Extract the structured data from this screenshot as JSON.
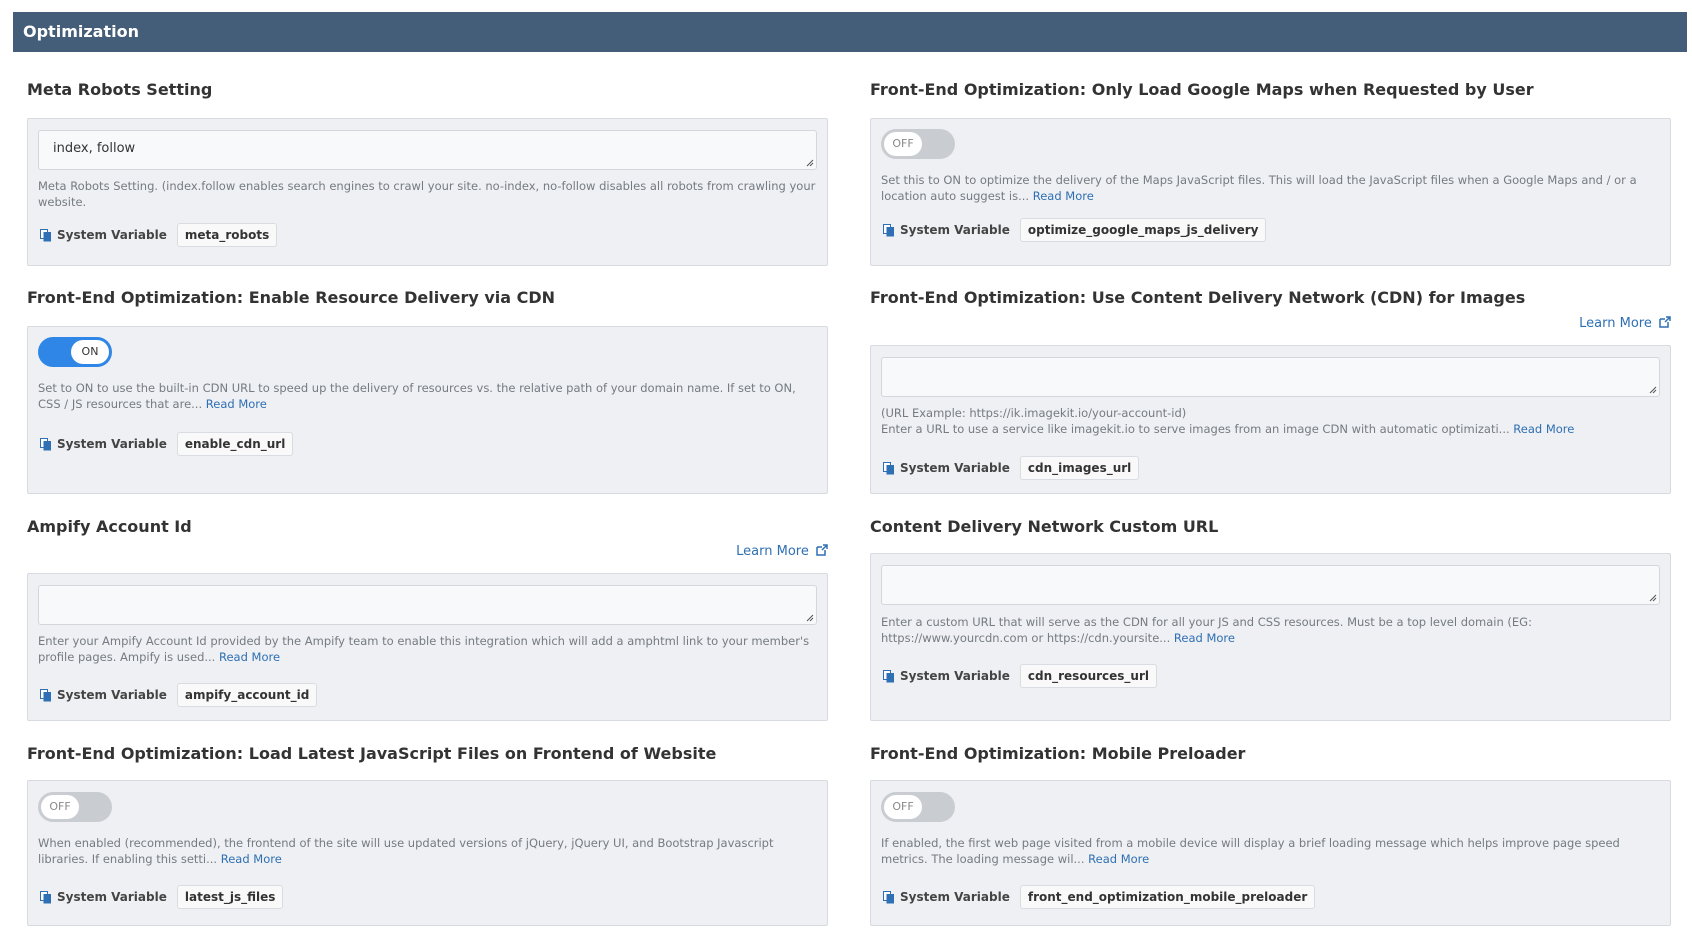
{
  "header": {
    "title": "Optimization"
  },
  "common": {
    "system_variable_label": "System Variable",
    "read_more": "Read More",
    "learn_more": "Learn More"
  },
  "fields": {
    "meta_robots": {
      "label": "Meta Robots Setting",
      "value": "index, follow",
      "description": "Meta Robots Setting. (index.follow enables search engines to crawl your site. no-index, no-follow disables all robots from crawling your website.",
      "variable": "meta_robots"
    },
    "google_maps": {
      "label": "Front-End Optimization: Only Load Google Maps when Requested by User",
      "toggle": "OFF",
      "description": "Set this to ON to optimize the delivery of the Maps JavaScript files. This will load the JavaScript files when a Google Maps and / or a location auto suggest is...",
      "variable": "optimize_google_maps_js_delivery"
    },
    "cdn_url": {
      "label": "Front-End Optimization: Enable Resource Delivery via CDN",
      "toggle": "ON",
      "description": "Set to ON to use the built-in CDN URL to speed up the delivery of resources vs. the relative path of your domain name. If set to ON, CSS / JS resources that are...",
      "variable": "enable_cdn_url"
    },
    "cdn_images": {
      "label": "Front-End Optimization: Use Content Delivery Network (CDN) for Images",
      "value": "",
      "example": "(URL Example: https://ik.imagekit.io/your-account-id)",
      "description": "Enter a URL to use a service like imagekit.io to serve images from an image CDN with automatic optimizati...",
      "variable": "cdn_images_url"
    },
    "ampify": {
      "label": "Ampify Account Id",
      "value": "",
      "description": "Enter your Ampify Account Id provided by the Ampify team to enable this integration which will add a amphtml link to your member's profile pages. Ampify is used...",
      "variable": "ampify_account_id"
    },
    "cdn_custom": {
      "label": "Content Delivery Network Custom URL",
      "value": "",
      "description": "Enter a custom URL that will serve as the CDN for all your JS and CSS resources. Must be a top level domain (EG: https://www.yourcdn.com or https://cdn.yoursite...",
      "variable": "cdn_resources_url"
    },
    "latest_js": {
      "label": "Front-End Optimization: Load Latest JavaScript Files on Frontend of Website",
      "toggle": "OFF",
      "description": "When enabled (recommended), the frontend of the site will use updated versions of jQuery, jQuery UI, and Bootstrap Javascript libraries.  If enabling this setti...",
      "variable": "latest_js_files"
    },
    "mobile_preloader": {
      "label": "Front-End Optimization: Mobile Preloader",
      "toggle": "OFF",
      "description": "If enabled, the first web page visited from a mobile device will display a brief loading message which helps improve page speed metrics. The loading message wil...",
      "variable": "front_end_optimization_mobile_preloader"
    }
  }
}
